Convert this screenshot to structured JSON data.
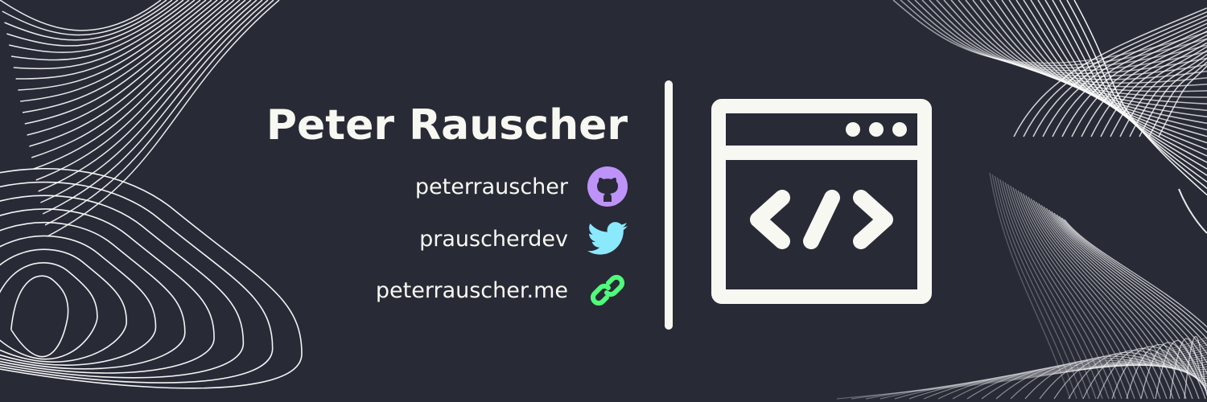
{
  "name": "Peter Rauscher",
  "links": [
    {
      "label": "peterrauscher",
      "icon": "github-icon",
      "color": "#bd93f9"
    },
    {
      "label": "prauscherdev",
      "icon": "twitter-icon",
      "color": "#8be9fd"
    },
    {
      "label": "peterrauscher.me",
      "icon": "link-icon",
      "color": "#50fa7b"
    }
  ],
  "colors": {
    "background": "#282a36",
    "foreground": "#f8f8f2"
  }
}
